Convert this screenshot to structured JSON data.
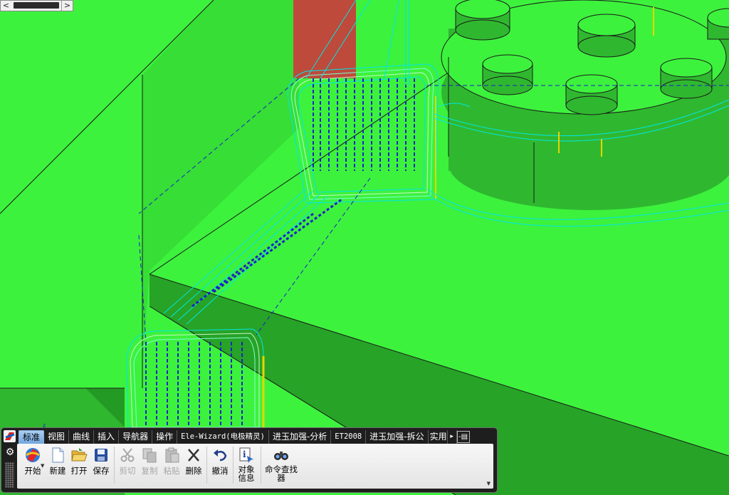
{
  "scrollbar": {
    "left_arrow": "<",
    "right_arrow": ">"
  },
  "ribbon": {
    "tabs": [
      {
        "label": "标准",
        "active": true
      },
      {
        "label": "视图"
      },
      {
        "label": "曲线"
      },
      {
        "label": "插入"
      },
      {
        "label": "导航器"
      },
      {
        "label": "操作"
      },
      {
        "label": "Ele-Wizard(电极精灵)"
      },
      {
        "label": "进玉加强-分析"
      },
      {
        "label": "ET2008"
      },
      {
        "label": "进玉加强-拆公"
      },
      {
        "label": "实用"
      }
    ],
    "tab_scroll_icon": "▸",
    "minimize_icon": "-▤",
    "buttons": {
      "start": "开始",
      "new": "新建",
      "open": "打开",
      "save": "保存",
      "cut": "剪切",
      "copy": "复制",
      "paste": "粘贴",
      "delete": "删除",
      "undo": "撤消",
      "info_line1": "对象",
      "info_line2": "信息",
      "finder_line1": "命令查找",
      "finder_line2": "器"
    }
  },
  "viewport": {
    "axis_label": "z",
    "colors": {
      "body": "#3df23d",
      "shaded": "#2fb82f",
      "dark": "#237e23",
      "red_face": "#bd4a3b",
      "toolpath_blue": "#1a22c8",
      "toolpath_cyan": "#00e6e6",
      "toolpath_yellow": "#e8d500"
    }
  }
}
